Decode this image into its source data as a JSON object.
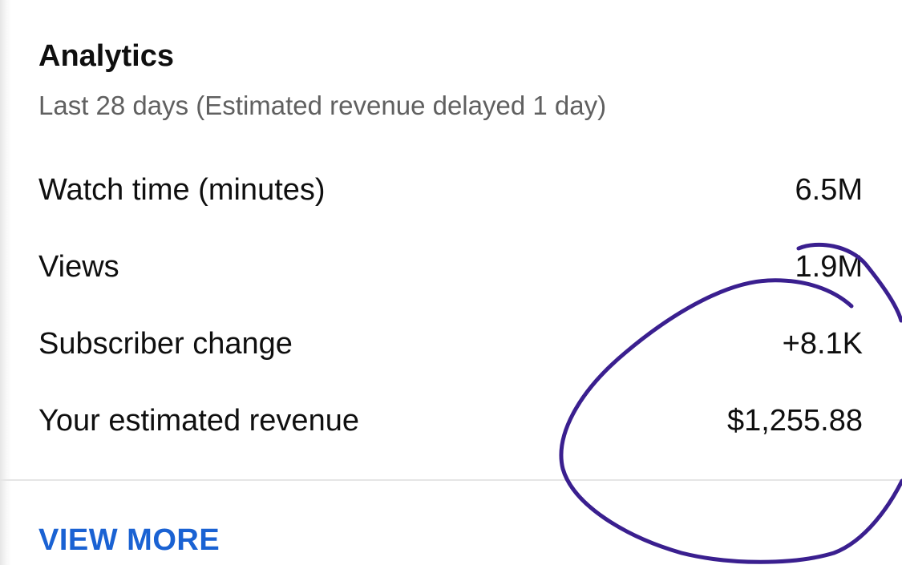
{
  "analytics": {
    "title": "Analytics",
    "subtitle": "Last 28 days (Estimated revenue delayed 1 day)",
    "metrics": [
      {
        "label": "Watch time (minutes)",
        "value": "6.5M"
      },
      {
        "label": "Views",
        "value": "1.9M"
      },
      {
        "label": "Subscriber change",
        "value": "+8.1K"
      },
      {
        "label": "Your estimated revenue",
        "value": "$1,255.88"
      }
    ],
    "view_more_label": "VIEW MORE"
  },
  "colors": {
    "link": "#1a62d3",
    "annotation_ink": "#3a1f8f",
    "secondary_text": "#606060"
  }
}
